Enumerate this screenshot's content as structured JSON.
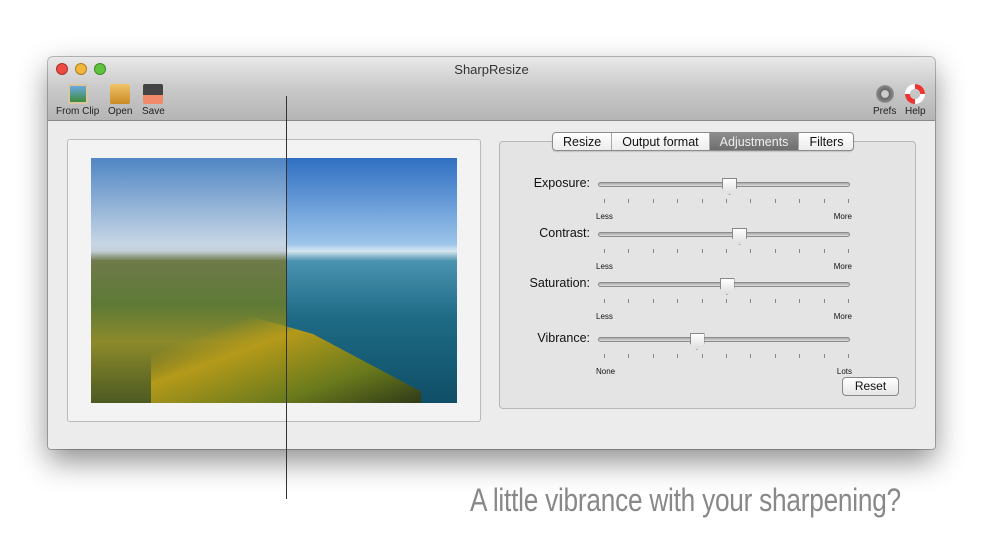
{
  "window": {
    "title": "SharpResize"
  },
  "toolbar": {
    "left": [
      {
        "label": "From Clip",
        "icon": "clipboard-image-icon"
      },
      {
        "label": "Open",
        "icon": "folder-icon"
      },
      {
        "label": "Save",
        "icon": "floppy-disk-icon"
      }
    ],
    "right": [
      {
        "label": "Prefs",
        "icon": "gear-icon"
      },
      {
        "label": "Help",
        "icon": "lifebuoy-icon"
      }
    ]
  },
  "tabs": [
    {
      "label": "Resize"
    },
    {
      "label": "Output format"
    },
    {
      "label": "Adjustments",
      "selected": true
    },
    {
      "label": "Filters"
    }
  ],
  "sliders": [
    {
      "label": "Exposure:",
      "min": "Less",
      "max": "More",
      "value": 0.52
    },
    {
      "label": "Contrast:",
      "min": "Less",
      "max": "More",
      "value": 0.56
    },
    {
      "label": "Saturation:",
      "min": "Less",
      "max": "More",
      "value": 0.51
    },
    {
      "label": "Vibrance:",
      "min": "None",
      "max": "Lots",
      "value": 0.39
    }
  ],
  "reset_label": "Reset",
  "caption": "A little vibrance with your sharpening?",
  "colors": {
    "close": "#ee4b43",
    "minimize": "#f2b63a",
    "zoom": "#5fc33b",
    "selected_tab": "#777777"
  }
}
